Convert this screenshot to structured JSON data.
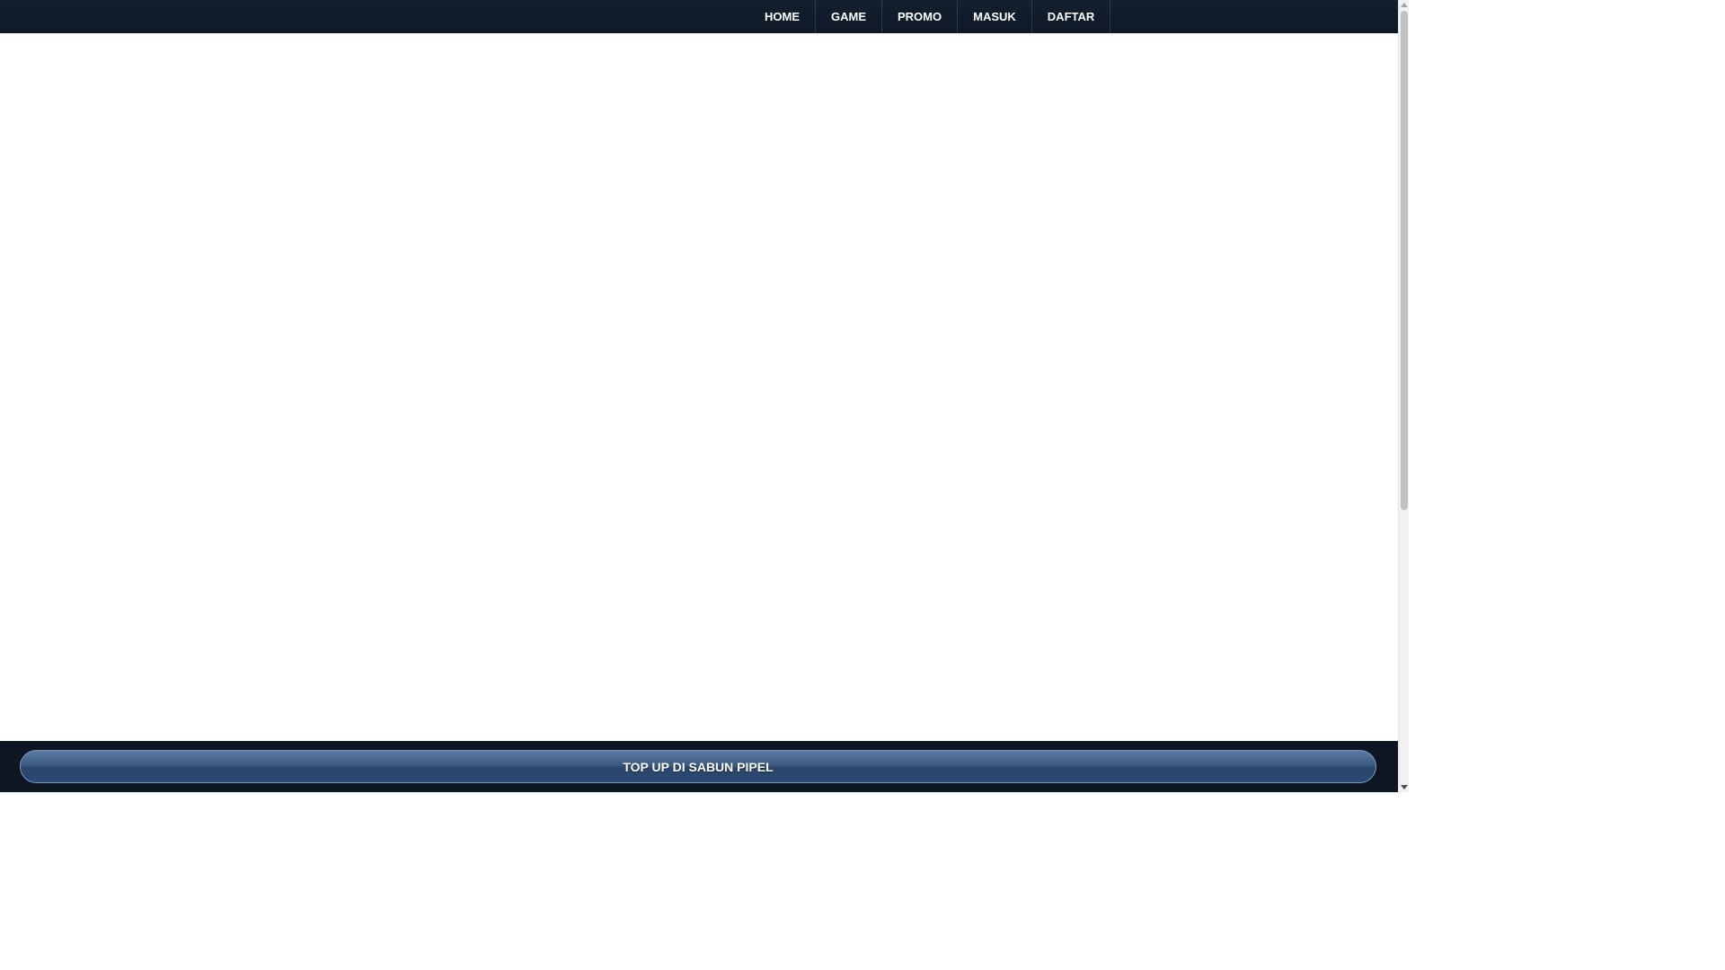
{
  "nav": {
    "items": [
      {
        "label": "HOME"
      },
      {
        "label": "GAME"
      },
      {
        "label": "PROMO"
      },
      {
        "label": "MASUK"
      },
      {
        "label": "DAFTAR"
      }
    ]
  },
  "footer": {
    "cta_label": "TOP UP DI SABUN PIPEL"
  },
  "icons": {
    "scroll_up": "chevron-up-icon",
    "scroll_down": "chevron-down-icon"
  },
  "colors": {
    "topbar": "#14202f",
    "footer": "#0d1622",
    "cta": "#3b5a82"
  }
}
